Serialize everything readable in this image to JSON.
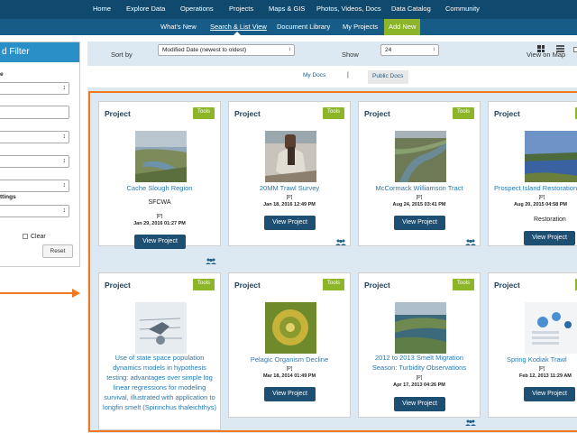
{
  "topnav": [
    "Home",
    "Explore Data",
    "Operations",
    "Projects",
    "Maps & GIS",
    "Photos, Videos, Docs",
    "Data Catalog",
    "Community"
  ],
  "subnav": [
    "What's New",
    "Search & List View",
    "Document Library",
    "My Projects",
    "Add New"
  ],
  "sidebar": {
    "heading": "d Filter",
    "label_top": "e",
    "label_settings": "ttings",
    "clear_label": "Clear",
    "reset_label": "Reset"
  },
  "sortbar": {
    "sort_label": "Sort by",
    "sort_value": "Modified Date (newest to oldest)",
    "show_label": "Show",
    "show_value": "24",
    "map_label": "View on Map"
  },
  "doctabs": {
    "my_docs": "My Docs",
    "separator": "|",
    "public_docs": "Public Docs"
  },
  "colors": {
    "nav_dark": "#0f4a6e",
    "nav_sub": "#165c86",
    "accent_green": "#8db529",
    "highlight": "#f07820",
    "button": "#1d4f73",
    "link": "#2579b0"
  },
  "card_common": {
    "type": "Project",
    "tools": "Tools",
    "button": "View Project",
    "tag": "[P]"
  },
  "cards": [
    {
      "name": "Cache Slough Region",
      "org": "SFCWA",
      "date": "Jan 29, 2016 01:27 PM"
    },
    {
      "name": "20MM Trawl Survey",
      "org": "",
      "date": "Jan 18, 2016 12:49 PM"
    },
    {
      "name": "McCormack Williamson Tract",
      "org": "",
      "date": "Aug 24, 2015 03:41 PM"
    },
    {
      "name": "Prospect Island Restoration",
      "org": "Restoration",
      "date": "Aug 20, 2015 04:58 PM"
    },
    {
      "name": "Use of state space population dynamics models in hypothesis testing: advantages over simple log linear regressions for modeling survival, illustrated with application to longfin smelt (Spirinchus thaleichthys)",
      "org": "",
      "date": ""
    },
    {
      "name": "Pelagic Organism Decline",
      "org": "",
      "date": "Mar 18, 2014 01:49 PM"
    },
    {
      "name": "2012 to 2013 Smelt Migration Season: Turbidity Observations",
      "org": "",
      "date": "Apr 17, 2013 04:26 PM"
    },
    {
      "name": "Spring Kodiak Trawl",
      "org": "",
      "date": "Feb 12, 2013 11:29 AM"
    }
  ]
}
